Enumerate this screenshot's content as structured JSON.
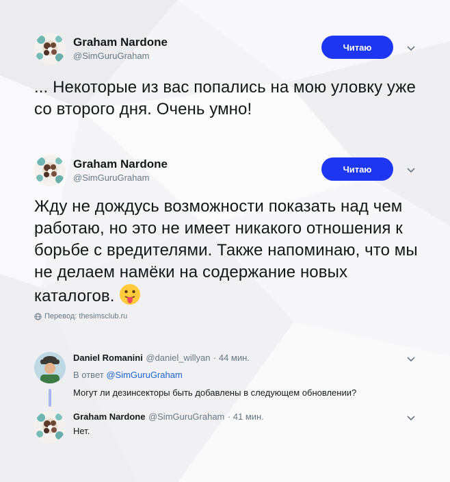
{
  "tweet1": {
    "name": "Graham Nardone",
    "handle": "@SimGuruGraham",
    "follow_label": "Читаю",
    "text": "... Некоторые из вас попались на мою уловку уже со второго дня. Очень умно!"
  },
  "tweet2": {
    "name": "Graham Nardone",
    "handle": "@SimGuruGraham",
    "follow_label": "Читаю",
    "text": "Жду не дождусь возможности показать над чем работаю, но это не имеет никакого отношения к борьбе с вредителями. Также напоминаю, что мы не делаем намёки на содержание новых каталогов.",
    "translation": "Перевод: thesimsclub.ru"
  },
  "reply1": {
    "name": "Daniel Romanini",
    "handle": "@daniel_willyan",
    "time": "· 44 мин.",
    "in_reply_prefix": "В ответ",
    "in_reply_mention": "@SimGuruGraham",
    "text": "Могут ли дезинсекторы быть добавлены в следующем обновлении?"
  },
  "reply2": {
    "name": "Graham Nardone",
    "handle": "@SimGuruGraham",
    "time": "· 41 мин.",
    "text": "Нет."
  },
  "colors": {
    "accent": "#1d36f2",
    "mention": "#1b63d6",
    "muted": "#657786",
    "thread_line": "#a9b7f0"
  },
  "icons": [
    "avatar-graham",
    "avatar-daniel",
    "chevron-down-icon",
    "globe-icon",
    "tongue-out-emoji"
  ]
}
